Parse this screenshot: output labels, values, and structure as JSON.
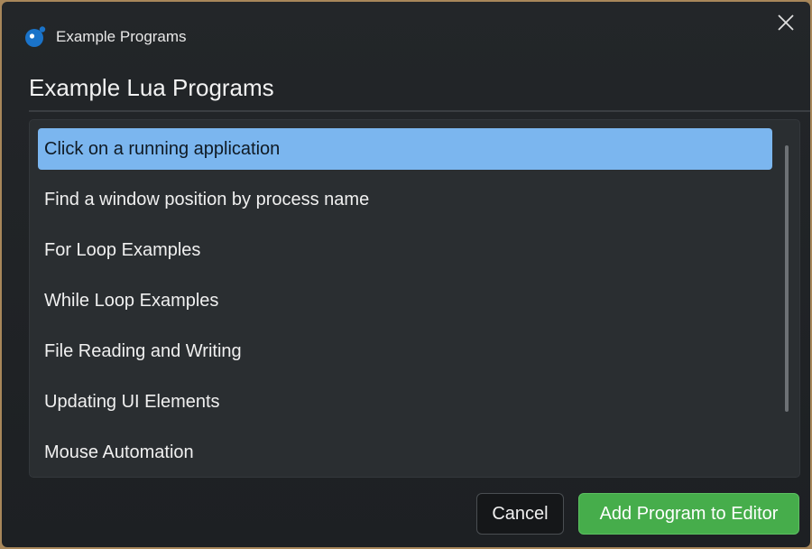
{
  "window": {
    "title": "Example Programs",
    "close_icon": "close-icon",
    "app_icon": "app-logo-icon"
  },
  "main": {
    "heading": "Example Lua Programs",
    "programs": [
      {
        "label": "Click on a running application",
        "selected": true
      },
      {
        "label": "Find a window position by process name",
        "selected": false
      },
      {
        "label": "For Loop Examples",
        "selected": false
      },
      {
        "label": "While Loop Examples",
        "selected": false
      },
      {
        "label": "File Reading and Writing",
        "selected": false
      },
      {
        "label": "Updating UI Elements",
        "selected": false
      },
      {
        "label": "Mouse Automation",
        "selected": false
      }
    ]
  },
  "footer": {
    "cancel_label": "Cancel",
    "add_label": "Add Program to Editor"
  },
  "colors": {
    "accent": "#46ad4b",
    "selection": "#7bb6ef",
    "logo": "#1a73c9"
  }
}
